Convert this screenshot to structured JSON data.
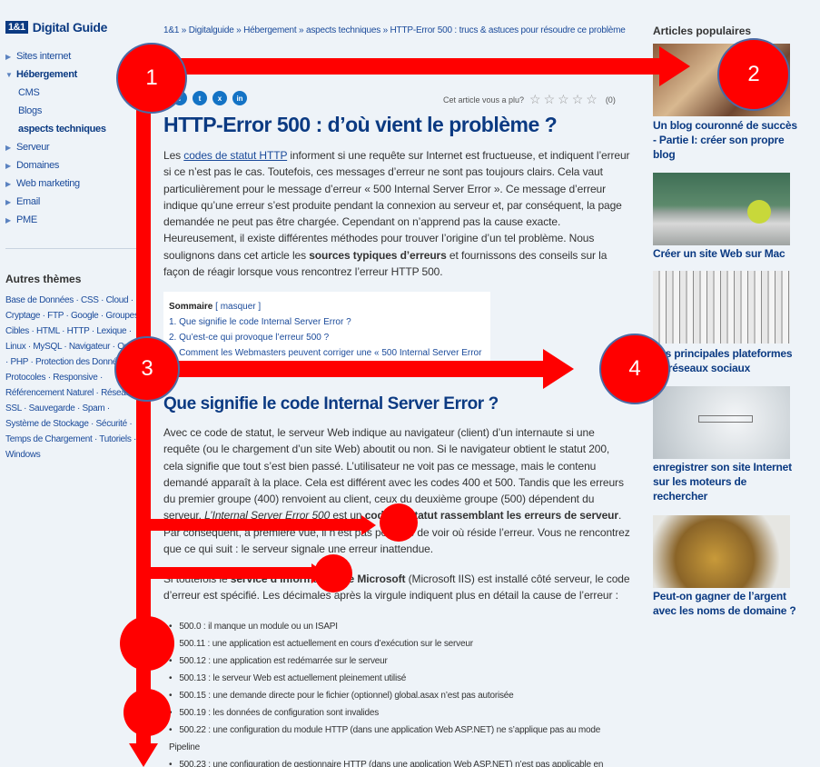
{
  "logo": {
    "box": "1&1",
    "text": "Digital Guide"
  },
  "nav": {
    "items": [
      {
        "label": "Sites internet",
        "type": "top"
      },
      {
        "label": "Hébergement",
        "type": "open"
      },
      {
        "label": "CMS",
        "type": "sub"
      },
      {
        "label": "Blogs",
        "type": "sub"
      },
      {
        "label": "aspects techniques",
        "type": "sub-bold"
      },
      {
        "label": "Serveur",
        "type": "top"
      },
      {
        "label": "Domaines",
        "type": "top"
      },
      {
        "label": "Web marketing",
        "type": "top"
      },
      {
        "label": "Email",
        "type": "top"
      },
      {
        "label": "PME",
        "type": "top"
      }
    ]
  },
  "themes": {
    "title": "Autres thèmes",
    "text": "Base de Données · CSS · Cloud · Cryptage · FTP · Google · Groupes Cibles · HTML · HTTP · Lexique · Linux · MySQL · Navigateur · Outils · PHP · Protection des Données · Protocoles · Responsive · Référencement Naturel · Réseau · SSL · Sauvegarde · Spam · Système de Stockage · Sécurité · Temps de Chargement · Tutoriels · Windows"
  },
  "breadcrumb": "1&1 » Digitalguide » Hébergement » aspects techniques » HTTP-Error 500 : trucs & astuces pour résoudre ce problème",
  "rating": {
    "label": "Cet article vous a plu?",
    "stars": "☆☆☆☆☆",
    "count": "(0)"
  },
  "article": {
    "title": "HTTP-Error 500 : d’où vient le problème ?",
    "intro_pre": "Les ",
    "intro_link": "codes de statut HTTP",
    "intro_post": " informent si une requête sur Internet est fructueuse, et indiquent l’erreur si ce n’est pas le cas. Toutefois, ces messages d’erreur ne sont pas toujours clairs. Cela vaut particulièrement pour le message d’erreur « 500 Internal Server Error ». Ce message d’erreur indique qu’une erreur s’est produite pendant la connexion au serveur et, par conséquent, la page demandée ne peut pas être chargée. Cependant on n’apprend pas la cause exacte. Heureusement, il existe différentes méthodes pour trouver l’origine d’un tel problème. Nous soulignons dans cet article les ",
    "intro_bold": "sources typiques d’erreurs",
    "intro_end": " et fournissons des conseils sur la façon de réagir lorsque vous rencontrez l’erreur HTTP 500.",
    "toc": {
      "title": "Sommaire",
      "toggle": "[ masquer ]",
      "items": [
        "1.  Que signifie le code Internal Server Error ?",
        "2.  Qu’est-ce qui provoque l’erreur 500 ?",
        "3.  Comment les Webmasters peuvent corriger une « 500 Internal Server Error » ?"
      ]
    },
    "h2": "Que signifie le code Internal Server Error ?",
    "p2": "Avec ce code de statut, le serveur Web indique au navigateur (client) d’un internaute si une requête (ou le chargement d’un site Web) aboutit ou non. Si le navigateur obtient le statut 200, cela signifie que tout s’est bien passé. L’utilisateur ne voit pas ce message, mais le contenu demandé apparaît à la place. Cela est différent avec les codes 400 et 500. Tandis que les erreurs du premier groupe (400) renvoient au client, ceux du deuxième groupe (500) dépendent du serveur. ",
    "p2_italic": "L’Internal Server Error 500",
    "p2_mid": " est un ",
    "p2_bold": "code de statut rassemblant les erreurs de serveur",
    "p2_end": ". Par conséquent, à première vue, il n’est pas possible de voir où réside l’erreur. Vous ne rencontrez que ce qui suit : le serveur signale une erreur inattendue.",
    "p3_pre": "Si toutefois le ",
    "p3_bold": "service d’information de Microsoft",
    "p3_end": " (Microsoft IIS) est installé côté serveur, le code d’erreur est spécifié. Les décimales après la virgule indiquent plus en détail la cause de l’erreur :",
    "codes": [
      "500.0 : il manque un module ou un ISAPI",
      "500.11 : une application est actuellement en cours d’exécution sur le serveur",
      "500.12 : une application est redémarrée sur le serveur",
      "500.13 : le serveur Web est actuellement pleinement utilisé",
      "500.15 : une demande directe pour le fichier (optionnel) global.asax n’est pas autorisée",
      "500.19 : les données de configuration sont invalides",
      "500.22 : une configuration du module HTTP (dans une application Web ASP.NET) ne s’applique pas au mode Pipeline",
      "500.23 : une configuration de gestionnaire HTTP (dans une application Web ASP.NET) n’est pas applicable en"
    ]
  },
  "popular": {
    "title": "Articles populaires",
    "articles": [
      {
        "title": "Un blog couronné de succès - Partie I: créer son propre blog",
        "thumb": "letters-image"
      },
      {
        "title": "Créer un site Web sur Mac",
        "thumb": "laptop-apple-image"
      },
      {
        "title": "Les principales plateformes de réseaux sociaux",
        "thumb": "social-media-image"
      },
      {
        "title": "enregistrer son site Internet sur les moteurs de rechercher",
        "thumb": "search-sketch-image"
      },
      {
        "title": "Peut-on gagner de l’argent avec les noms de domaine ?",
        "thumb": "coins-jar-image"
      }
    ]
  },
  "annotations": {
    "markers": [
      "1",
      "2",
      "3",
      "4"
    ],
    "color": "#ff0000"
  }
}
